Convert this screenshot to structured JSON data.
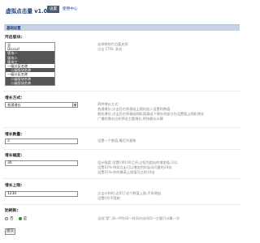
{
  "header": {
    "app_title": "虚拟点击量 v1.0.1",
    "tab_active": "设置",
    "tab_other": "使用中心"
  },
  "section": {
    "title": "基础设置"
  },
  "fields": {
    "categories": {
      "label": "开启版块:",
      "desc": "选择哪些栏目要启用\n点击 CTRL 多选",
      "options": [
        {
          "text": "全",
          "kind": "normal"
        },
        {
          "text": "Discuz!",
          "kind": "normal"
        },
        {
          "text": "版块一",
          "kind": "sel"
        },
        {
          "text": "版块二",
          "kind": "sel"
        },
        {
          "text": "版块三",
          "kind": "sel"
        },
        {
          "text": "一级分区名称",
          "kind": "normal"
        },
        {
          "text": "二级版块名称",
          "kind": "subsel"
        },
        {
          "text": "一级分区名称",
          "kind": "normal"
        },
        {
          "text": "二级版块名称",
          "kind": "subsel"
        },
        {
          "text": "二级版块名称",
          "kind": "subsel"
        }
      ]
    },
    "growth_mode": {
      "label": "增长方式:",
      "value": "普通增长",
      "desc": "两种增长方式:\n普通增长:点击后在原基础上随机加入设置的数值\n随机增长:点击后在原基础随机值基础下增长的部分在设置值上随机增长\n广播的增长比你预设主题增长,将按最长计算"
    },
    "base_value": {
      "label": "增长数量:",
      "value": "3",
      "desc": "设置一个数值,最后为基数"
    },
    "max_value": {
      "label": "增长幅度:",
      "value": "30",
      "desc": "设计幅度:设置1到100之间,过低为超出的增加值,可以\n设置10%:例如点击可以增加到实际访问量的10倍\n设置10%:你的最高上限值可达的10倍"
    },
    "upper_limit": {
      "label": "增长上限:",
      "value": "1230",
      "desc": "点击计划时,达到了这个数值上限,不再增加\n设置0为不限制"
    },
    "anti_cheat": {
      "label": "防刷新:",
      "option_no": "否",
      "option_yes": "是",
      "desc": "当选\"是\",同一IP在同一时间内访问同一主题只计算一次"
    },
    "submit_label": "提交"
  }
}
